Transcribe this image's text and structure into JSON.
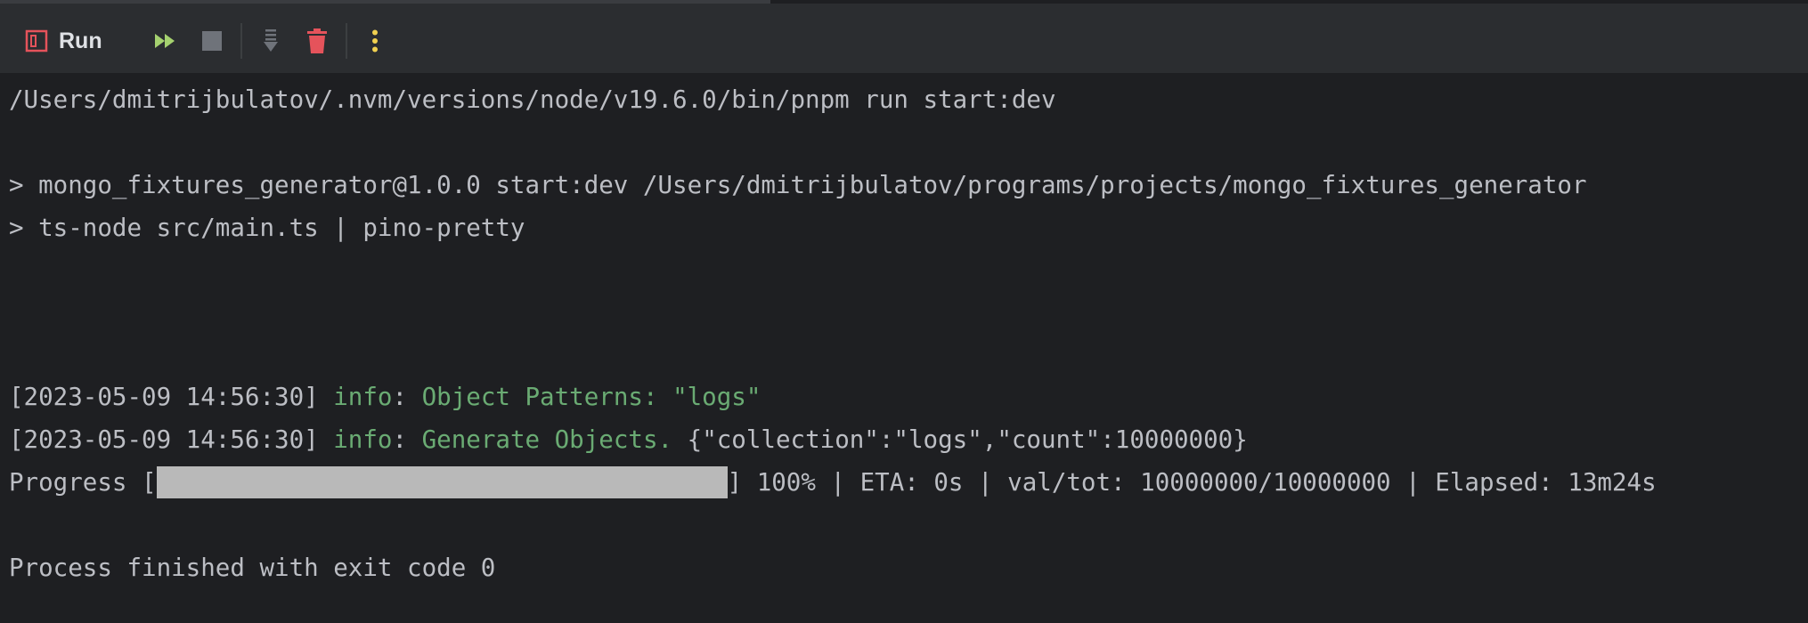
{
  "toolbar": {
    "run_label": "Run",
    "buttons": [
      {
        "name": "rerun-icon",
        "color": "#8fc16b"
      },
      {
        "name": "stop-icon",
        "color": "#6f737a"
      },
      {
        "name": "scroll-to-end-icon",
        "color": "#6f737a"
      },
      {
        "name": "clear-all-icon",
        "color": "#e5535b"
      },
      {
        "name": "more-options-icon",
        "color": "#f0d050"
      }
    ]
  },
  "console": {
    "command": "/Users/dmitrijbulatov/.nvm/versions/node/v19.6.0/bin/pnpm run start:dev",
    "script_line_1": "> mongo_fixtures_generator@1.0.0 start:dev /Users/dmitrijbulatov/programs/projects/mongo_fixtures_generator",
    "script_line_2": "> ts-node src/main.ts | pino-pretty",
    "log_1": {
      "timestamp": "[2023-05-09 14:56:30] ",
      "level": "info",
      "sep": ": ",
      "message": "Object Patterns: \"logs\""
    },
    "log_2": {
      "timestamp": "[2023-05-09 14:56:30] ",
      "level": "info",
      "sep": ": ",
      "message": "Generate Objects.",
      "payload": " {\"collection\":\"logs\",\"count\":10000000}"
    },
    "progress": {
      "prefix": "Progress [",
      "fraction": 1.0,
      "suffix": "] 100% | ETA: 0s | val/tot: 10000000/10000000 | Elapsed: 13m24s"
    },
    "exit_message": "Process finished with exit code 0"
  },
  "colors": {
    "background": "#1e1f22",
    "toolbar": "#2b2d30",
    "text": "#bcbec4",
    "info_green": "#6aab73",
    "progress_fill": "#b9b9b9"
  }
}
